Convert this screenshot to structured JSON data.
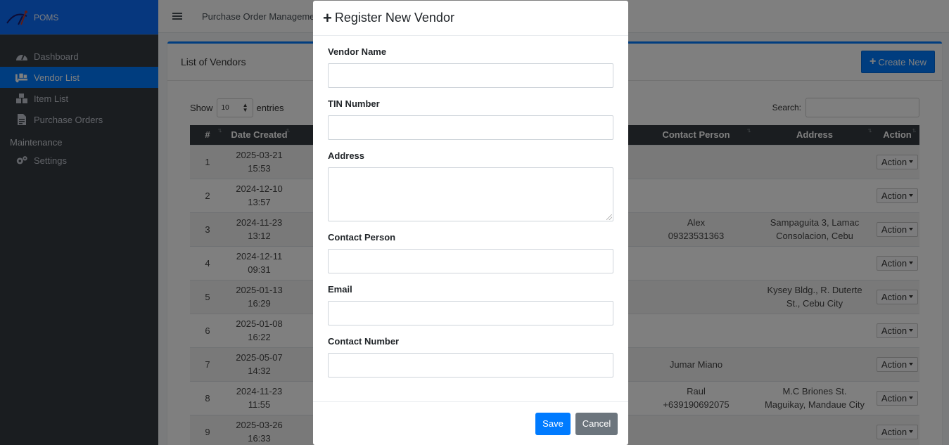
{
  "app": {
    "brand": "POMS",
    "topbar_title": "Purchase Order Management"
  },
  "sidebar": {
    "items": [
      {
        "label": "Dashboard",
        "icon": "tachometer-icon",
        "active": false
      },
      {
        "label": "Vendor List",
        "icon": "truck-loading-icon",
        "active": true
      },
      {
        "label": "Item List",
        "icon": "boxes-icon",
        "active": false
      },
      {
        "label": "Purchase Orders",
        "icon": "file-invoice-icon",
        "active": false
      }
    ],
    "maintenance_header": "Maintenance",
    "settings_label": "Settings"
  },
  "card": {
    "title": "List of Vendors",
    "create_label": "Create New",
    "show_label": "Show",
    "entries_value": "10",
    "entries_label": "entries",
    "search_label": "Search:"
  },
  "table": {
    "headers": [
      "#",
      "Date Created",
      "Contact Person",
      "Address",
      "Action"
    ],
    "action_label": "Action",
    "rows": [
      {
        "num": "1",
        "date": "2025-03-21",
        "time": "15:53",
        "contact1": "",
        "contact2": "",
        "addr1": "",
        "addr2": ""
      },
      {
        "num": "2",
        "date": "2024-12-10",
        "time": "13:57",
        "contact1": "",
        "contact2": "",
        "addr1": "",
        "addr2": ""
      },
      {
        "num": "3",
        "date": "2024-11-23",
        "time": "13:12",
        "contact1": "Alex",
        "contact2": "09323531363",
        "addr1": "Sampaguita 3, Lamac",
        "addr2": "Consolacion, Cebu"
      },
      {
        "num": "4",
        "date": "2024-12-11",
        "time": "09:31",
        "contact1": "",
        "contact2": "",
        "addr1": "",
        "addr2": ""
      },
      {
        "num": "5",
        "date": "2025-01-13",
        "time": "16:29",
        "contact1": "",
        "contact2": "",
        "addr1": "Kysey Bldg., R. Duterte",
        "addr2": "St., Cebu City"
      },
      {
        "num": "6",
        "date": "2025-01-08",
        "time": "16:22",
        "contact1": "",
        "contact2": "",
        "addr1": "",
        "addr2": ""
      },
      {
        "num": "7",
        "date": "2025-05-07",
        "time": "14:32",
        "contact1": "Jumar Miano",
        "contact2": "",
        "addr1": "",
        "addr2": ""
      },
      {
        "num": "8",
        "date": "2024-11-23",
        "time": "11:55",
        "contact1": "Raul",
        "contact2": "+639190692075",
        "addr1": "M.C Briones St.",
        "addr2": "Maguikay, Mandaue City"
      },
      {
        "num": "9",
        "date": "2025-03-26",
        "time": "16:33",
        "contact1": "",
        "contact2": "",
        "addr1": "",
        "addr2": ""
      }
    ]
  },
  "modal": {
    "title": "Register New Vendor",
    "fields": {
      "vendor_name": {
        "label": "Vendor Name",
        "value": ""
      },
      "tin": {
        "label": "TIN Number",
        "value": ""
      },
      "address": {
        "label": "Address",
        "value": ""
      },
      "contact_person": {
        "label": "Contact Person",
        "value": ""
      },
      "email": {
        "label": "Email",
        "value": ""
      },
      "contact_number": {
        "label": "Contact Number",
        "value": ""
      }
    },
    "save_label": "Save",
    "cancel_label": "Cancel"
  },
  "colors": {
    "primary": "#007bff",
    "sidebar": "#343a40",
    "secondary": "#6c757d"
  }
}
